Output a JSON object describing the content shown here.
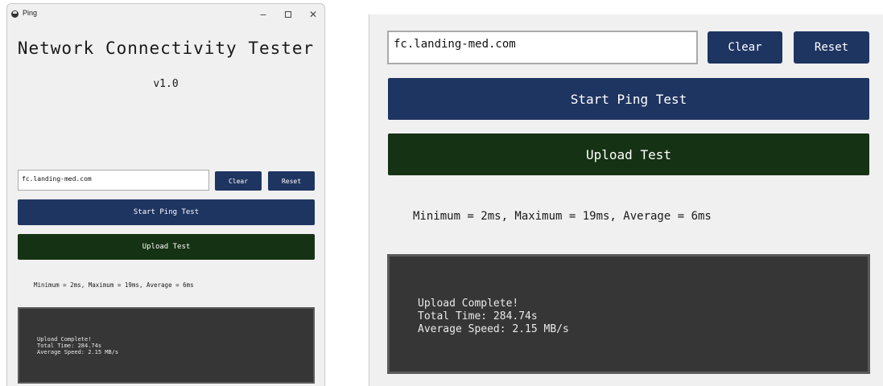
{
  "window": {
    "title": "Ping",
    "controls": {
      "minimize": "−",
      "close": "✕"
    }
  },
  "app": {
    "title": "Network Connectivity Tester",
    "version": "v1.0"
  },
  "host_input": {
    "value": "fc.landing-med.com"
  },
  "buttons": {
    "clear": "Clear",
    "reset": "Reset",
    "start_ping": "Start Ping Test",
    "upload": "Upload Test"
  },
  "ping_stats": "Minimum = 2ms, Maximum = 19ms, Average = 6ms",
  "upload_log": {
    "lines": [
      "Upload Complete!",
      "Total Time: 284.74s",
      "Average Speed: 2.15 MB/s"
    ]
  },
  "colors": {
    "primary_button": "#1f3561",
    "upload_button": "#163214",
    "log_background": "#363636",
    "window_background": "#f0f0f0"
  },
  "icons": {
    "app": "ping-app-icon",
    "minimize": "minimize-icon",
    "maximize": "maximize-icon",
    "close": "close-icon"
  }
}
